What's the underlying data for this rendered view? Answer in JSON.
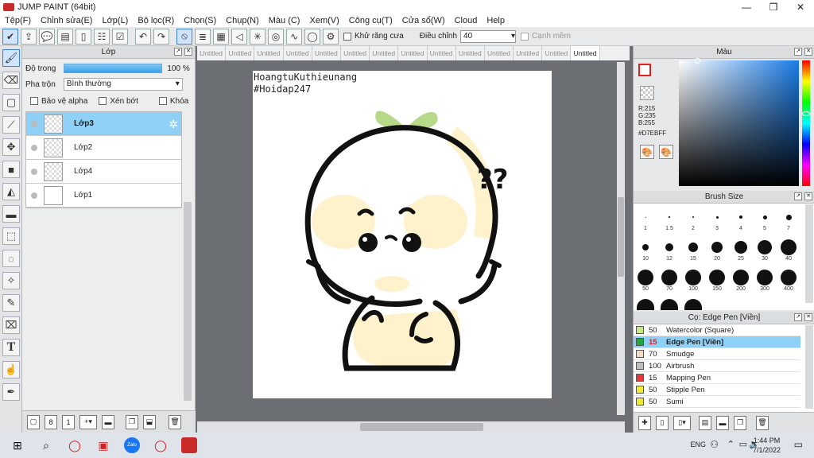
{
  "window": {
    "title": "JUMP PAINT (64bit)"
  },
  "menu": [
    "Tệp(F)",
    "Chỉnh sửa(E)",
    "Lớp(L)",
    "Bộ lọc(R)",
    "Chọn(S)",
    "Chụp(N)",
    "Màu (C)",
    "Xem(V)",
    "Công cụ(T)",
    "Cửa sổ(W)",
    "Cloud",
    "Help"
  ],
  "toolbar": {
    "antialias_label": "Khử răng cưa",
    "adjust_label": "Điều chỉnh",
    "adjust_value": "40",
    "edge_label": "Cạnh mềm"
  },
  "layer_panel": {
    "title": "Lớp",
    "opacity_label": "Độ trong",
    "opacity_value": "100 %",
    "blend_label": "Pha trộn",
    "blend_value": "Bình thường",
    "protect_alpha": "Bảo vệ alpha",
    "clipping": "Xén bớt",
    "lock": "Khóa",
    "layers": [
      {
        "name": "Lớp3",
        "active": true
      },
      {
        "name": "Lớp2",
        "active": false
      },
      {
        "name": "Lớp4",
        "active": false
      },
      {
        "name": "Lớp1",
        "active": false
      }
    ]
  },
  "canvas": {
    "tabs": [
      "Untitled",
      "Untitled",
      "Untitled",
      "Untitled",
      "Untitled",
      "Untitled",
      "Untitled",
      "Untitled",
      "Untitled",
      "Untitled",
      "Untitled",
      "Untitled",
      "Untitled",
      "Untitled"
    ],
    "watermark_line1": "HoangtuKuthieunang",
    "watermark_line2": "#Hoidap247"
  },
  "color_panel": {
    "title": "Màu",
    "r": "R:215",
    "g": "G:235",
    "b": "B:255",
    "hex": "#D7EBFF",
    "primary_color": "#d7ebff",
    "fg_color": "#e02020"
  },
  "brush_panel": {
    "title": "Brush Size",
    "sizes": [
      "1",
      "1.5",
      "2",
      "3",
      "4",
      "5",
      "7",
      "10",
      "12",
      "15",
      "20",
      "25",
      "30",
      "40",
      "50",
      "70",
      "100",
      "150",
      "200",
      "300",
      "400"
    ]
  },
  "subtool_panel": {
    "title": "Cọ: Edge Pen [Viền]",
    "items": [
      {
        "size": "50",
        "name": "Watercolor (Square)",
        "color": "#c8e88a",
        "active": false
      },
      {
        "size": "15",
        "name": "Edge Pen [Viền]",
        "color": "#1fa83a",
        "active": true
      },
      {
        "size": "70",
        "name": "Smudge",
        "color": "#f3dcc4",
        "active": false
      },
      {
        "size": "100",
        "name": "Airbrush",
        "color": "#c0c0c0",
        "active": false
      },
      {
        "size": "15",
        "name": "Mapping Pen",
        "color": "#e8383a",
        "active": false
      },
      {
        "size": "50",
        "name": "Stipple Pen",
        "color": "#f2e93a",
        "active": false
      },
      {
        "size": "50",
        "name": "Sumi",
        "color": "#f2e93a",
        "active": false
      }
    ]
  },
  "taskbar": {
    "time": "1:44 PM",
    "date": "7/1/2022",
    "lang": "ENG"
  }
}
